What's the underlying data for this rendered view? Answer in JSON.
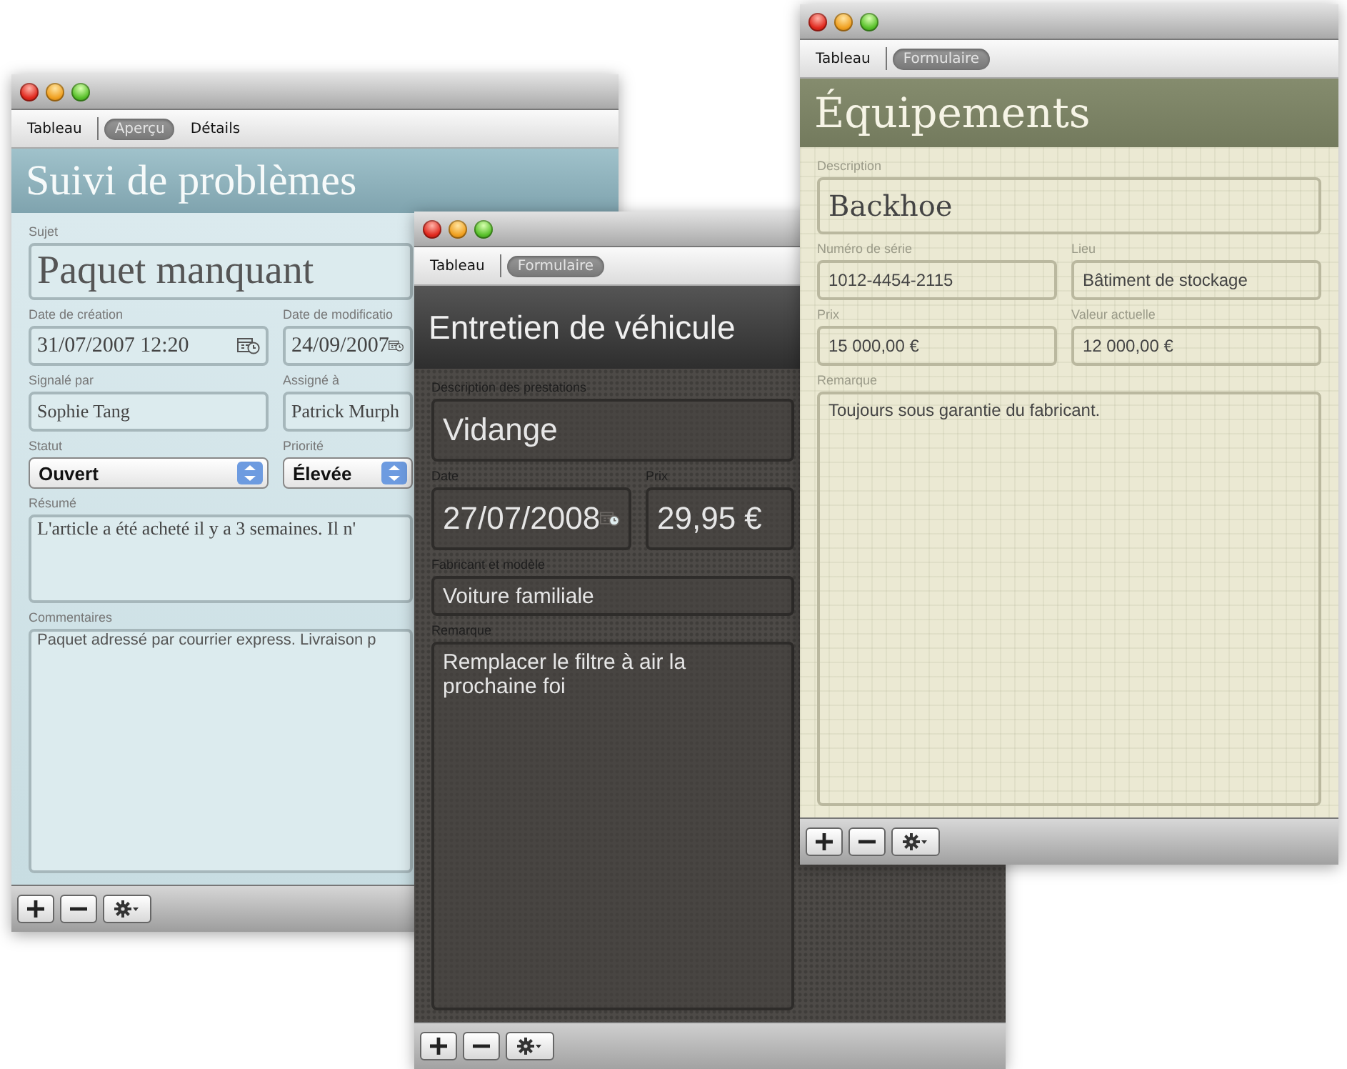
{
  "windows": [
    {
      "kind": "issues",
      "tabs": [
        {
          "label": "Tableau",
          "selected": false
        },
        {
          "label": "Aperçu",
          "selected": true
        },
        {
          "label": "Détails",
          "selected": false
        }
      ],
      "title": "Suivi de problèmes",
      "rows": [
        [
          {
            "kind": "headline",
            "label": "Sujet",
            "value": "Paquet manquant"
          }
        ],
        [
          {
            "kind": "date",
            "label": "Date de création",
            "value": "31/07/2007 12:20"
          },
          {
            "kind": "date",
            "label": "Date de modificatio",
            "value": "24/09/2007"
          }
        ],
        [
          {
            "kind": "text",
            "label": "Signalé par",
            "value": "Sophie Tang"
          },
          {
            "kind": "text",
            "label": "Assigné à",
            "value": "Patrick Murph"
          }
        ],
        [
          {
            "kind": "popup",
            "label": "Statut",
            "value": "Ouvert"
          },
          {
            "kind": "popup",
            "label": "Priorité",
            "value": "Élevée"
          }
        ],
        [
          {
            "kind": "note",
            "label": "Résumé",
            "value": "L'article a été acheté il y a 3 semaines. Il n'"
          }
        ],
        [
          {
            "kind": "comment",
            "label": "Commentaires",
            "value": "Paquet adressé par courrier express. Livraison p"
          }
        ]
      ]
    },
    {
      "kind": "vehicles",
      "tabs": [
        {
          "label": "Tableau",
          "selected": false
        },
        {
          "label": "Formulaire",
          "selected": true
        }
      ],
      "title": "Entretien de véhicule",
      "rows": [
        [
          {
            "kind": "headline",
            "label": "Description des prestations",
            "value": "Vidange"
          }
        ],
        [
          {
            "kind": "date",
            "label": "Date",
            "value": "27/07/2008"
          },
          {
            "kind": "headline",
            "label": "Prix",
            "value": "29,95 €"
          }
        ],
        [
          {
            "kind": "text",
            "label": "Fabricant et modèle",
            "value": "Voiture familiale"
          }
        ],
        [
          {
            "kind": "note",
            "label": "Remarque",
            "value": "Remplacer le filtre à air la prochaine foi"
          }
        ]
      ]
    },
    {
      "kind": "equipment",
      "tabs": [
        {
          "label": "Tableau",
          "selected": false
        },
        {
          "label": "Formulaire",
          "selected": true
        }
      ],
      "title": "Équipements",
      "rows": [
        [
          {
            "kind": "headline",
            "label": "Description",
            "value": "Backhoe"
          }
        ],
        [
          {
            "kind": "text",
            "label": "Numéro de série",
            "value": "1012-4454-2115"
          },
          {
            "kind": "text",
            "label": "Lieu",
            "value": "Bâtiment de stockage"
          }
        ],
        [
          {
            "kind": "text",
            "label": "Prix",
            "value": "15 000,00 €"
          },
          {
            "kind": "text",
            "label": "Valeur actuelle",
            "value": "12 000,00 €"
          }
        ],
        [
          {
            "kind": "note",
            "label": "Remarque",
            "value": "Toujours sous garantie du fabricant."
          }
        ]
      ]
    }
  ]
}
